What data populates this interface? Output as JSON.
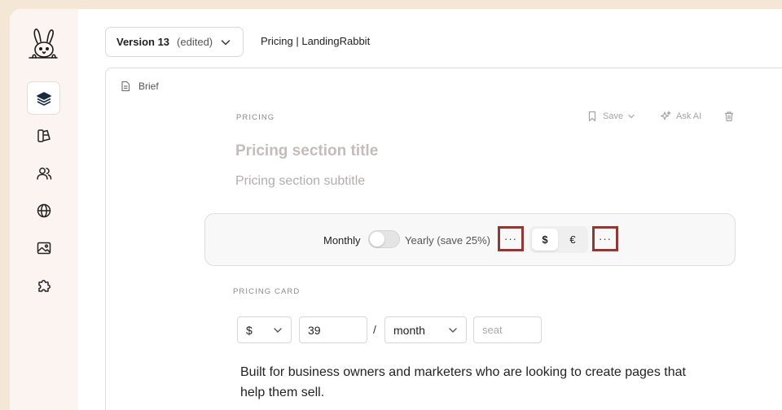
{
  "header": {
    "version_name": "Version 13",
    "version_status": "(edited)",
    "page_title": "Pricing | LandingRabbit"
  },
  "sidebar": {
    "items": [
      {
        "name": "layers-icon",
        "active": true
      },
      {
        "name": "components-icon",
        "active": false
      },
      {
        "name": "users-icon",
        "active": false
      },
      {
        "name": "globe-icon",
        "active": false
      },
      {
        "name": "image-icon",
        "active": false
      },
      {
        "name": "puzzle-icon",
        "active": false
      }
    ]
  },
  "editor": {
    "brief_label": "Brief",
    "section_label": "PRICING",
    "toolbar": {
      "save_label": "Save",
      "ask_ai_label": "Ask AI"
    },
    "title_placeholder": "Pricing section title",
    "subtitle_placeholder": "Pricing section subtitle",
    "billing": {
      "monthly_label": "Monthly",
      "yearly_label": "Yearly (save 25%)",
      "yearly_enabled": false,
      "more_label": "···"
    },
    "currency": {
      "options": [
        "$",
        "€"
      ],
      "selected": "$",
      "more_label": "···"
    },
    "card": {
      "section_label": "PRICING CARD",
      "currency_value": "$",
      "price_value": "39",
      "separator": "/",
      "period_value": "month",
      "unit_placeholder": "seat",
      "description": "Built for business owners and marketers who are looking to create pages that help them sell."
    }
  },
  "colors": {
    "background": "#f4e7d6",
    "sidebar": "#fcf4f1",
    "highlight_border": "#8d3a36"
  }
}
